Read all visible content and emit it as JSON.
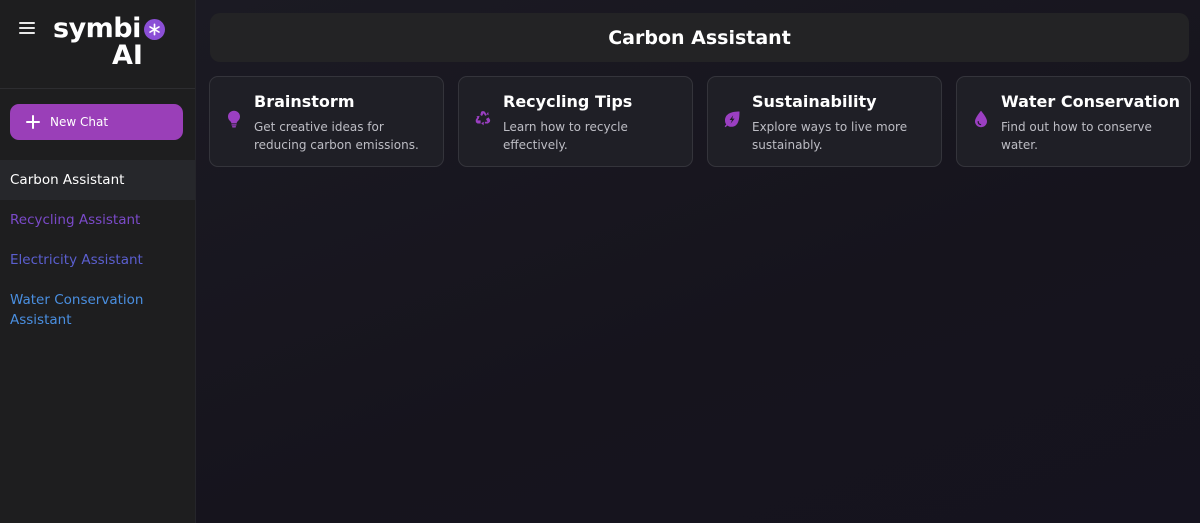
{
  "logo": {
    "line1": "symbi",
    "line2": "AI"
  },
  "sidebar": {
    "new_chat_label": "New Chat",
    "items": [
      {
        "label": "Carbon Assistant",
        "color": "#ffffff",
        "active": true
      },
      {
        "label": "Recycling Assistant",
        "color": "#7b4ac9",
        "active": false
      },
      {
        "label": "Electricity Assistant",
        "color": "#5b5fcf",
        "active": false
      },
      {
        "label": "Water Conservation Assistant",
        "color": "#4a8fe0",
        "active": false
      }
    ]
  },
  "header": {
    "title": "Carbon Assistant"
  },
  "cards": [
    {
      "icon": "lightbulb-icon",
      "title": "Brainstorm",
      "description": "Get creative ideas for reducing carbon emissions."
    },
    {
      "icon": "recycle-icon",
      "title": "Recycling Tips",
      "description": "Learn how to recycle effectively."
    },
    {
      "icon": "leaf-bolt-icon",
      "title": "Sustainability",
      "description": "Explore ways to live more sustainably."
    },
    {
      "icon": "water-drop-icon",
      "title": "Water Conservation",
      "description": "Find out how to conserve water."
    }
  ],
  "colors": {
    "accent": "#9a3fb8",
    "icon": "#9b3fc2",
    "logo_badge": "#8b4fd6",
    "sidebar_bg": "#1e1e1f",
    "main_bg": "#16141d"
  }
}
